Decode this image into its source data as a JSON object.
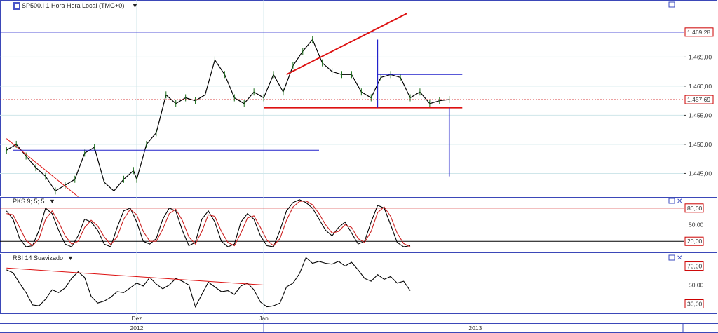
{
  "header": {
    "symbol_title": "SP500.I 1 Hora Hora Local (TMG+0)",
    "pks_title": "PKS 9; 5; 5",
    "rsi_title": "RSI 14 Suavizado"
  },
  "icons": {
    "symbol_logo": "chart-logo-icon",
    "dropdown": "chevron-down-icon",
    "maximize": "maximize-icon",
    "close": "close-icon"
  },
  "colors": {
    "price": "#000000",
    "trendline": "#dd1111",
    "blue_level": "#2222cc",
    "current_price": "#cc0000",
    "pks_fast": "#000000",
    "pks_slow": "#cc2222",
    "rsi_upper": "#cc0000",
    "rsi_lower": "#007700",
    "grid": "#cfe6ea"
  },
  "chart_data": [
    {
      "type": "line",
      "name": "price",
      "y_ticks": [
        "1.465,00",
        "1.460,00",
        "1.455,00",
        "1.450,00",
        "1.445,00"
      ],
      "tagged_values": {
        "resistance": "1.469,28",
        "last": "1.457,69"
      },
      "ylim": [
        1441.2,
        1474.8
      ],
      "x": [
        0,
        3,
        6,
        9,
        12,
        15,
        18,
        21,
        24,
        27,
        30,
        33,
        36,
        39,
        40,
        43,
        46,
        49,
        52,
        55,
        58,
        61,
        64,
        67,
        70,
        73,
        76,
        79,
        82,
        85,
        88,
        91,
        94,
        97,
        100,
        103,
        106,
        109,
        112,
        115,
        118,
        121,
        124,
        127,
        130,
        133,
        136
      ],
      "values": [
        1449.0,
        1450.0,
        1448.0,
        1446.0,
        1444.5,
        1442.0,
        1443.0,
        1444.0,
        1448.5,
        1449.5,
        1443.5,
        1442.0,
        1444.0,
        1445.5,
        1444.0,
        1450.0,
        1452.0,
        1458.5,
        1457.0,
        1458.0,
        1457.5,
        1458.5,
        1464.5,
        1462.0,
        1458.0,
        1457.0,
        1459.0,
        1458.0,
        1462.0,
        1459.0,
        1463.5,
        1466.0,
        1468.0,
        1464.0,
        1462.5,
        1462.0,
        1462.0,
        1459.0,
        1458.0,
        1461.5,
        1462.0,
        1461.5,
        1458.0,
        1459.0,
        1457.0,
        1457.5,
        1457.7
      ],
      "x_labels": [
        {
          "x": 40,
          "text": "Dez"
        },
        {
          "x": 79,
          "text": "Jan"
        },
        {
          "x": 40,
          "text": "2012"
        },
        {
          "x": 144,
          "text": "2013"
        }
      ],
      "xlim": [
        -2,
        208
      ]
    },
    {
      "type": "line",
      "name": "pks",
      "y_ticks": [
        "50,00"
      ],
      "tagged_values": {
        "upper": "80,00",
        "lower": "20,00"
      },
      "ylim": [
        0,
        100
      ],
      "x": [
        0,
        2,
        4,
        6,
        8,
        10,
        12,
        14,
        16,
        18,
        20,
        22,
        24,
        26,
        28,
        30,
        32,
        34,
        36,
        38,
        40,
        42,
        44,
        46,
        48,
        50,
        52,
        54,
        56,
        58,
        60,
        62,
        64,
        66,
        68,
        70,
        72,
        74,
        76,
        78,
        80,
        82,
        84,
        86,
        88,
        90,
        92,
        94,
        96,
        98,
        100,
        102,
        104,
        106,
        108,
        110,
        112,
        114,
        116,
        118,
        120,
        122,
        124
      ],
      "series": [
        {
          "values": [
            75,
            60,
            25,
            10,
            12,
            40,
            80,
            70,
            40,
            15,
            10,
            30,
            60,
            55,
            40,
            15,
            10,
            45,
            75,
            80,
            55,
            20,
            15,
            25,
            60,
            80,
            75,
            40,
            12,
            18,
            60,
            75,
            55,
            20,
            10,
            15,
            55,
            70,
            60,
            30,
            12,
            10,
            40,
            75,
            90,
            95,
            90,
            80,
            60,
            40,
            30,
            45,
            55,
            35,
            15,
            20,
            55,
            85,
            80,
            50,
            18,
            10,
            12
          ]
        },
        {
          "values": [
            70,
            68,
            45,
            22,
            12,
            25,
            60,
            75,
            55,
            30,
            15,
            20,
            45,
            58,
            48,
            28,
            14,
            28,
            60,
            78,
            68,
            38,
            20,
            20,
            42,
            70,
            78,
            58,
            28,
            15,
            38,
            68,
            65,
            38,
            18,
            12,
            35,
            62,
            66,
            45,
            22,
            12,
            25,
            58,
            82,
            92,
            93,
            86,
            70,
            50,
            35,
            38,
            50,
            45,
            25,
            18,
            38,
            72,
            82,
            65,
            35,
            16,
            10
          ]
        }
      ],
      "xlim": [
        -2,
        208
      ]
    },
    {
      "type": "line",
      "name": "rsi",
      "y_ticks": [
        "50,00"
      ],
      "tagged_values": {
        "upper": "70,00",
        "lower": "30,00"
      },
      "ylim": [
        20,
        83
      ],
      "x": [
        0,
        2,
        4,
        6,
        8,
        10,
        12,
        14,
        16,
        18,
        20,
        22,
        24,
        26,
        28,
        30,
        32,
        34,
        36,
        38,
        40,
        42,
        44,
        46,
        48,
        50,
        52,
        54,
        56,
        58,
        60,
        62,
        64,
        66,
        68,
        70,
        72,
        74,
        76,
        78,
        80,
        82,
        84,
        86,
        88,
        90,
        92,
        94,
        96,
        98,
        100,
        102,
        104,
        106,
        108,
        110,
        112,
        114,
        116,
        118,
        120,
        122,
        124
      ],
      "values": [
        66,
        63,
        52,
        42,
        29,
        28,
        35,
        45,
        42,
        47,
        57,
        64,
        58,
        38,
        31,
        33,
        37,
        43,
        42,
        47,
        52,
        49,
        58,
        51,
        46,
        50,
        57,
        54,
        50,
        27,
        40,
        53,
        48,
        43,
        44,
        40,
        49,
        52,
        45,
        32,
        27,
        28,
        31,
        48,
        52,
        62,
        79,
        73,
        75,
        73,
        72,
        75,
        70,
        74,
        66,
        57,
        54,
        61,
        56,
        59,
        52,
        54,
        44
      ],
      "xlim": [
        -2,
        208
      ]
    }
  ]
}
